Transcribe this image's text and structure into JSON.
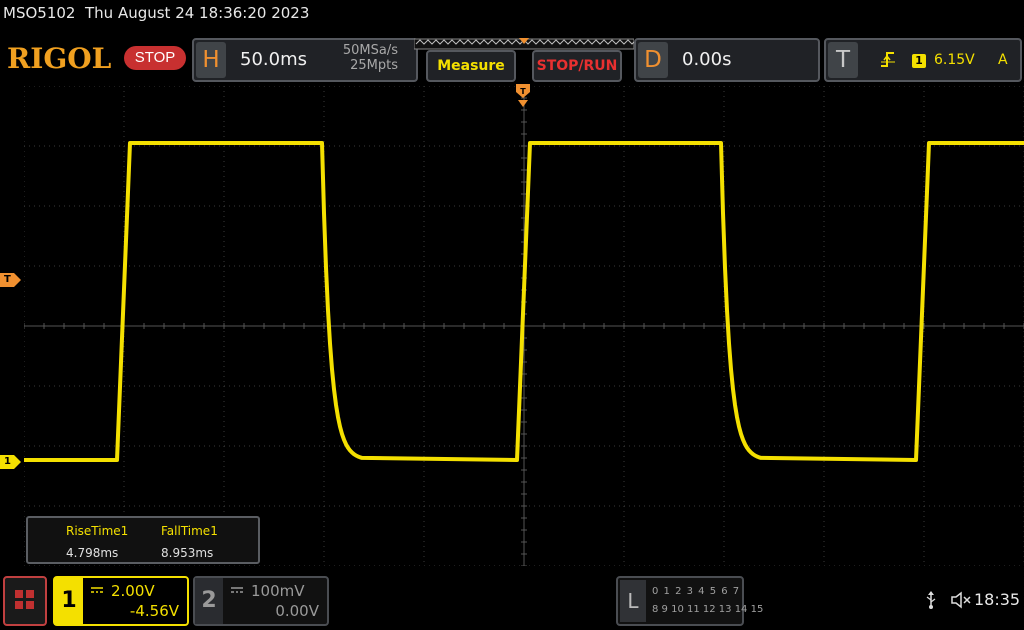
{
  "status": {
    "model": "MSO5102",
    "datetime": "Thu August 24 18:36:20 2023"
  },
  "brand": "RIGOL",
  "run_state": "STOP",
  "horizontal": {
    "tag": "H",
    "timebase": "50.0ms",
    "sample_rate": "50MSa/s",
    "memory_depth": "25Mpts"
  },
  "buttons": {
    "measure": "Measure",
    "stop_run": "STOP/RUN"
  },
  "delay": {
    "tag": "D",
    "value": "0.00s"
  },
  "trigger": {
    "tag": "T",
    "edge_icon": "rising-edge-icon",
    "source": "1",
    "level": "6.15V",
    "mode": "A"
  },
  "markers": {
    "trigger_level": "T",
    "ch1": "1"
  },
  "measurements": [
    {
      "name": "RiseTime1",
      "value": "4.798ms"
    },
    {
      "name": "FallTime1",
      "value": "8.953ms"
    }
  ],
  "channels": [
    {
      "number": "1",
      "scale": "2.00V",
      "offset": "-4.56V",
      "color": "#f4e000"
    },
    {
      "number": "2",
      "scale": "100mV",
      "offset": "0.00V",
      "color": "#9a9a9a"
    }
  ],
  "logic": {
    "tag": "L",
    "row1": "0 1 2 3  4 5 6 7",
    "row2": "8 9 10 11 12 13 14 15"
  },
  "system": {
    "usb_icon": "usb-icon",
    "speaker_icon": "speaker-muted-icon",
    "time": "18:35"
  },
  "colors": {
    "trace": "#f4e000",
    "accent": "#f09030",
    "stop": "#c83030"
  }
}
